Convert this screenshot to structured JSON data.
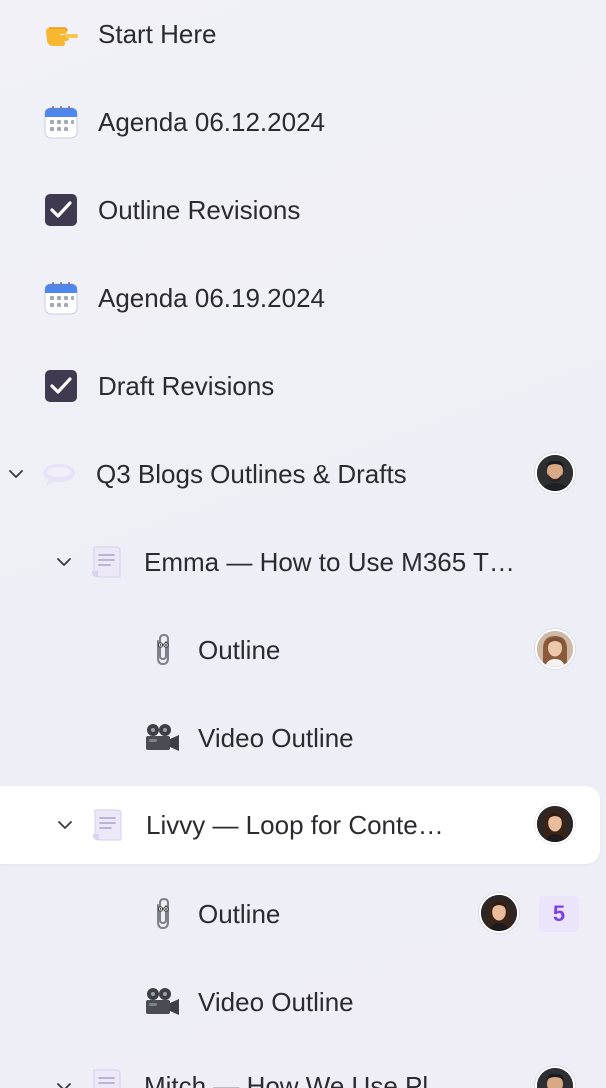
{
  "tree": {
    "items": [
      {
        "label": "Start Here",
        "icon": "pointing-hand-icon"
      },
      {
        "label": "Agenda 06.12.2024",
        "icon": "calendar-icon"
      },
      {
        "label": "Outline Revisions",
        "icon": "checkbox-icon"
      },
      {
        "label": "Agenda 06.19.2024",
        "icon": "calendar-icon"
      },
      {
        "label": "Draft Revisions",
        "icon": "checkbox-icon"
      },
      {
        "label": "Q3 Blogs Outlines & Drafts",
        "icon": "speech-bubble-icon",
        "expanded": true,
        "has_avatar": true
      },
      {
        "label": "Emma — How to Use M365 T…",
        "icon": "document-icon",
        "expanded": true
      },
      {
        "label": "Outline",
        "icon": "paperclip-icon",
        "has_avatar": true
      },
      {
        "label": "Video Outline",
        "icon": "movie-camera-icon"
      },
      {
        "label": "Livvy — Loop for Conte…",
        "icon": "document-icon",
        "expanded": true,
        "selected": true,
        "has_avatar": true
      },
      {
        "label": "Outline",
        "icon": "paperclip-icon",
        "has_avatar": true,
        "badge": "5"
      },
      {
        "label": "Video Outline",
        "icon": "movie-camera-icon"
      },
      {
        "label": "Mitch — How We Use Pl…",
        "icon": "document-icon",
        "expanded": true,
        "has_avatar": true
      }
    ]
  },
  "colors": {
    "background": "#eeeff6",
    "selected_row": "#ffffff",
    "text": "#2b2b2f",
    "badge_bg": "#ebe4fb",
    "badge_text": "#7a42e0"
  }
}
